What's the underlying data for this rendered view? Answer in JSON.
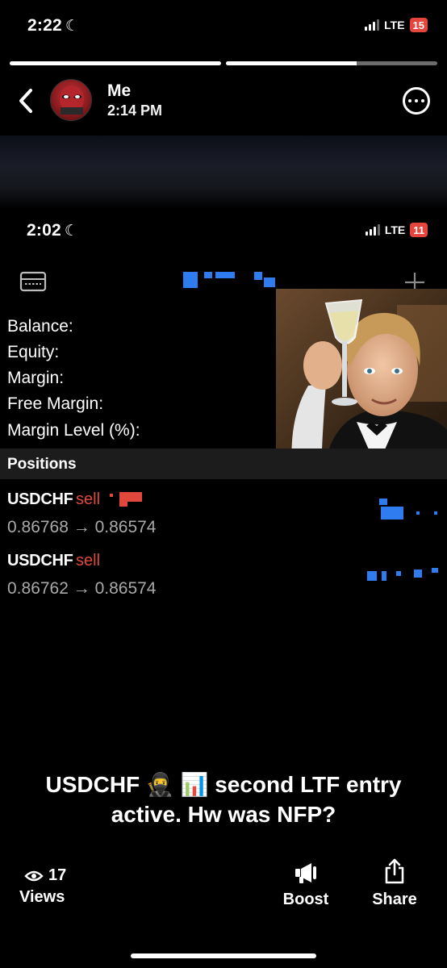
{
  "status_outer": {
    "time": "2:22",
    "network": "LTE",
    "battery": "15",
    "battery_color": "#e5453c"
  },
  "story": {
    "progress": [
      1.0,
      0.62
    ]
  },
  "header": {
    "name": "Me",
    "time": "2:14 PM"
  },
  "embedded": {
    "status": {
      "time": "2:02",
      "network": "LTE",
      "battery": "11",
      "battery_color": "#e5453c"
    },
    "account": {
      "balance_label": "Balance:",
      "equity_label": "Equity:",
      "margin_label": "Margin:",
      "free_margin_label": "Free Margin:",
      "margin_level_label": "Margin Level (%):"
    },
    "positions_title": "Positions",
    "positions": [
      {
        "symbol": "USDCHF",
        "side": "sell",
        "prices": "0.86768 → 0.86574"
      },
      {
        "symbol": "USDCHF",
        "side": "sell",
        "prices": "0.86762 → 0.86574"
      }
    ],
    "sticker": "celebration-toast-image"
  },
  "caption": {
    "line1": "USDCHF 🥷 📊 second LTF entry",
    "line2": "active. Hw was  NFP?"
  },
  "footer": {
    "views_count": "17",
    "views_label": "Views",
    "boost_label": "Boost",
    "share_label": "Share"
  },
  "colors": {
    "accent_blue": "#2f7bf0",
    "sell_red": "#e0483c",
    "background": "#000000"
  }
}
